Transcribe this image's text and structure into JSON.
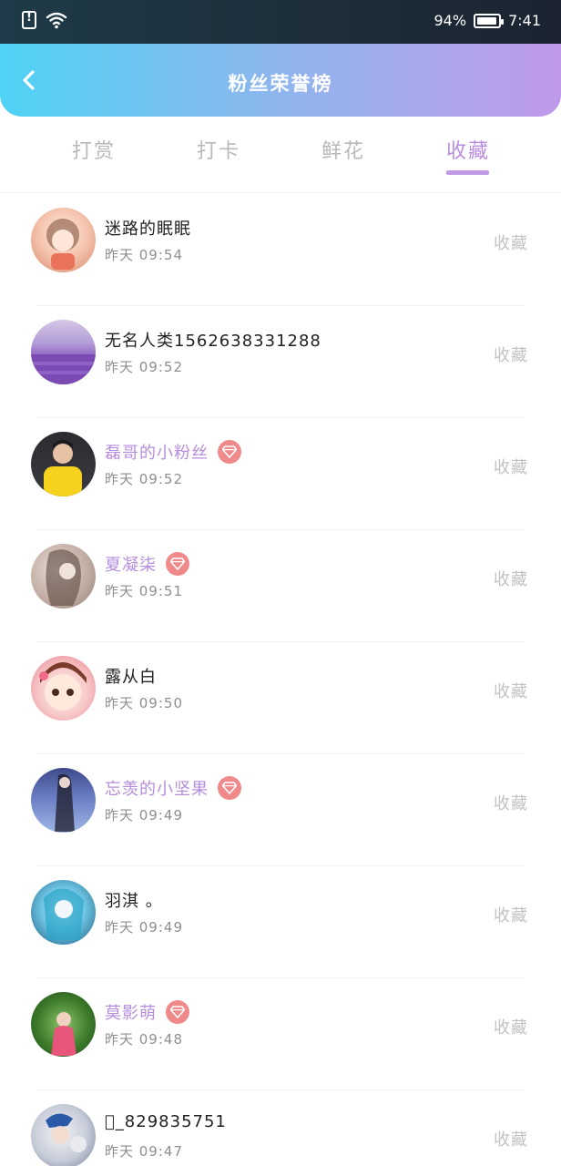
{
  "status_bar": {
    "battery_percent": "94%",
    "time": "7:41",
    "battery_level": 0.94,
    "icons": [
      "sim-alert-icon",
      "wifi-icon",
      "battery-icon"
    ]
  },
  "header": {
    "title": "粉丝荣誉榜",
    "back_icon": "chevron-left-icon"
  },
  "tabs": [
    {
      "label": "打赏",
      "active": false
    },
    {
      "label": "打卡",
      "active": false
    },
    {
      "label": "鲜花",
      "active": false
    },
    {
      "label": "收藏",
      "active": true
    }
  ],
  "colors": {
    "accent": "#b98ee0",
    "vip_name": "#b68ddc",
    "vip_badge": "#f08a8a",
    "header_gradient_start": "#4fd2f5",
    "header_gradient_end": "#c09aea"
  },
  "entries": [
    {
      "name": "迷路的眠眠",
      "time": "昨天 09:54",
      "action": "收藏",
      "vip": false
    },
    {
      "name": "无名人类1562638331288",
      "time": "昨天 09:52",
      "action": "收藏",
      "vip": false
    },
    {
      "name": "磊哥的小粉丝",
      "time": "昨天 09:52",
      "action": "收藏",
      "vip": true
    },
    {
      "name": "夏凝柒",
      "time": "昨天 09:51",
      "action": "收藏",
      "vip": true
    },
    {
      "name": "露从白",
      "time": "昨天 09:50",
      "action": "收藏",
      "vip": false
    },
    {
      "name": "忘羡的小坚果",
      "time": "昨天 09:49",
      "action": "收藏",
      "vip": true
    },
    {
      "name": "羽淇 。",
      "time": "昨天 09:49",
      "action": "收藏",
      "vip": false
    },
    {
      "name": "莫影萌",
      "time": "昨天 09:48",
      "action": "收藏",
      "vip": true
    },
    {
      "name": "\u0000_829835751",
      "time": "昨天 09:47",
      "action": "收藏",
      "vip": false
    }
  ]
}
